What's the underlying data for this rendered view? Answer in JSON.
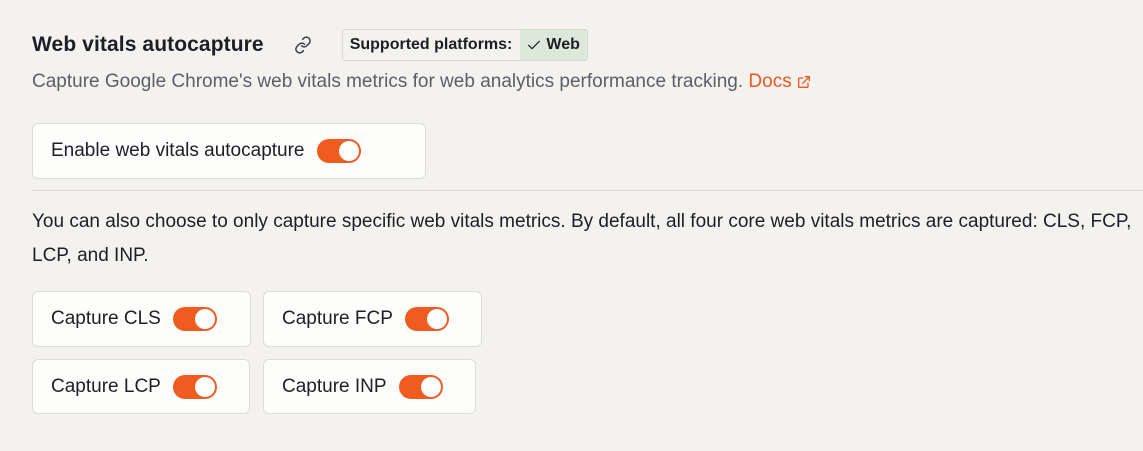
{
  "header": {
    "title": "Web vitals autocapture",
    "link_icon": "link-icon",
    "platforms_label": "Supported platforms:",
    "platform": "Web",
    "platform_icon": "check-icon"
  },
  "description": {
    "text": "Capture Google Chrome's web vitals metrics for web analytics performance tracking.",
    "docs_label": "Docs",
    "docs_icon": "external-link-icon"
  },
  "main_toggle": {
    "label": "Enable web vitals autocapture",
    "enabled": true
  },
  "helper_text": "You can also choose to only capture specific web vitals metrics. By default, all four core web vitals metrics are captured: CLS, FCP, LCP, and INP.",
  "metrics": [
    {
      "label": "Capture CLS",
      "enabled": true
    },
    {
      "label": "Capture FCP",
      "enabled": true
    },
    {
      "label": "Capture LCP",
      "enabled": true
    },
    {
      "label": "Capture INP",
      "enabled": true
    }
  ],
  "colors": {
    "accent": "#f05b1f",
    "link": "#e8591f",
    "platform_bg": "#dce9da",
    "background": "#f3f2ef"
  }
}
